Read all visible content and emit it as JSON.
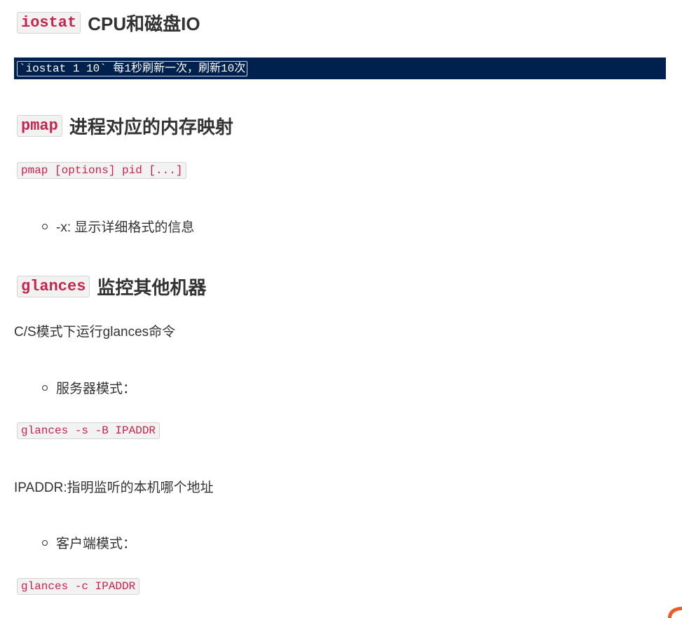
{
  "sections": {
    "iostat": {
      "code": "iostat",
      "title": "CPU和磁盘IO",
      "example": "`iostat 1 10` 每1秒刷新一次，刷新10次"
    },
    "pmap": {
      "code": "pmap",
      "title": "进程对应的内存映射",
      "usage": "pmap [options] pid [...]",
      "options": [
        "-x: 显示详细格式的信息"
      ]
    },
    "glances": {
      "code": "glances",
      "title": "监控其他机器",
      "intro": "C/S模式下运行glances命令",
      "server_mode_label": "服务器模式：",
      "server_command": "glances -s -B IPADDR",
      "ipaddr_note": "IPADDR:指明监听的本机哪个地址",
      "client_mode_label": "客户端模式：",
      "client_command": "glances -c IPADDR"
    }
  },
  "colors": {
    "code_text": "#c7254e",
    "code_bg": "#f2f2f2",
    "selection_bar": "#00214d",
    "corner_icon": "#f05a28"
  },
  "icons": {
    "corner": "app-logo-icon",
    "bullet": "hollow-circle-bullet-icon"
  }
}
